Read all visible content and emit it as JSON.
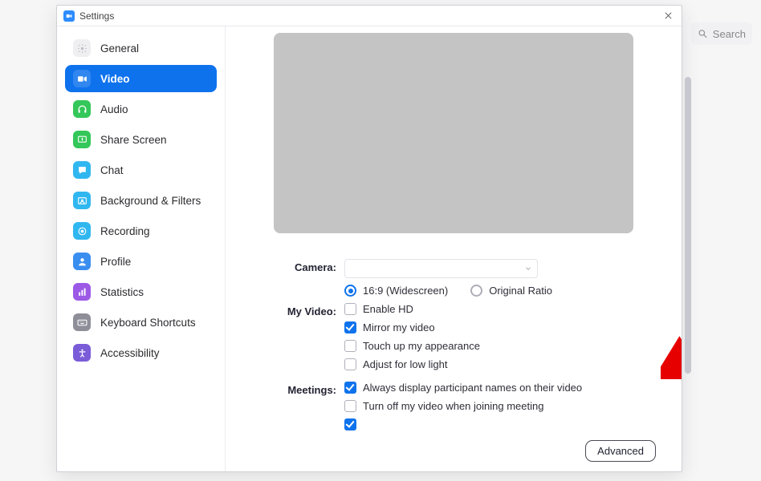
{
  "search": {
    "placeholder": "Search"
  },
  "modal": {
    "title": "Settings"
  },
  "sidebar": {
    "items": [
      {
        "label": "General",
        "icon": "gear-icon",
        "bg": "#efeff1",
        "fg": "#bdbdc6"
      },
      {
        "label": "Video",
        "icon": "video-icon",
        "bg": "#ffffff",
        "fg": "#ffffff",
        "active": true
      },
      {
        "label": "Audio",
        "icon": "headphones-icon",
        "bg": "#34c759",
        "fg": "#ffffff"
      },
      {
        "label": "Share Screen",
        "icon": "share-screen-icon",
        "bg": "#34c759",
        "fg": "#ffffff"
      },
      {
        "label": "Chat",
        "icon": "chat-icon",
        "bg": "#31b7f0",
        "fg": "#ffffff"
      },
      {
        "label": "Background & Filters",
        "icon": "background-icon",
        "bg": "#31b7f0",
        "fg": "#ffffff"
      },
      {
        "label": "Recording",
        "icon": "record-icon",
        "bg": "#31b7f0",
        "fg": "#ffffff"
      },
      {
        "label": "Profile",
        "icon": "profile-icon",
        "bg": "#3a8ef0",
        "fg": "#ffffff"
      },
      {
        "label": "Statistics",
        "icon": "statistics-icon",
        "bg": "#9b59e6",
        "fg": "#ffffff"
      },
      {
        "label": "Keyboard Shortcuts",
        "icon": "keyboard-icon",
        "bg": "#8e8e98",
        "fg": "#ffffff"
      },
      {
        "label": "Accessibility",
        "icon": "accessibility-icon",
        "bg": "#7a5cd8",
        "fg": "#ffffff"
      }
    ]
  },
  "video": {
    "camera_label": "Camera:",
    "ratio_16_9": "16:9 (Widescreen)",
    "ratio_original": "Original Ratio",
    "myvideo_label": "My Video:",
    "enable_hd": "Enable HD",
    "mirror": "Mirror my video",
    "touchup": "Touch up my appearance",
    "lowlight": "Adjust for low light",
    "meetings_label": "Meetings:",
    "always_names": "Always display participant names on their video",
    "turn_off_join": "Turn off my video when joining meeting"
  },
  "advanced_label": "Advanced"
}
